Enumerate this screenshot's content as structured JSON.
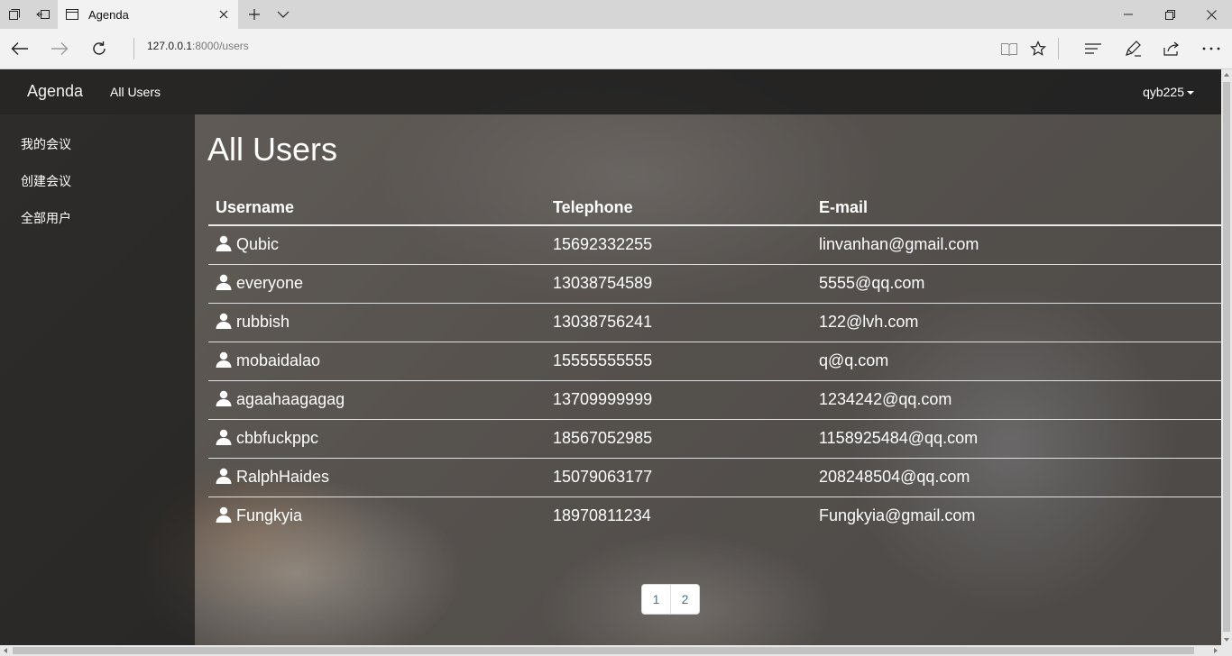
{
  "browser": {
    "tab_title": "Agenda",
    "url_host": "127.0.0.1",
    "url_path": ":8000/users"
  },
  "navbar": {
    "brand": "Agenda",
    "link": "All Users",
    "user": "qyb225"
  },
  "sidebar": {
    "items": [
      {
        "label": "我的会议"
      },
      {
        "label": "创建会议"
      },
      {
        "label": "全部用户"
      }
    ]
  },
  "main": {
    "title": "All Users",
    "columns": [
      "Username",
      "Telephone",
      "E-mail"
    ],
    "rows": [
      {
        "username": "Qubic",
        "telephone": "15692332255",
        "email": "linvanhan@gmail.com"
      },
      {
        "username": "everyone",
        "telephone": "13038754589",
        "email": "5555@qq.com"
      },
      {
        "username": "rubbish",
        "telephone": "13038756241",
        "email": "122@lvh.com"
      },
      {
        "username": "mobaidalao",
        "telephone": "15555555555",
        "email": "q@q.com"
      },
      {
        "username": "agaahaagagag",
        "telephone": "13709999999",
        "email": "1234242@qq.com"
      },
      {
        "username": "cbbfuckppc",
        "telephone": "18567052985",
        "email": "1158925484@qq.com"
      },
      {
        "username": "RalphHaides",
        "telephone": "15079063177",
        "email": "208248504@qq.com"
      },
      {
        "username": "Fungkyia",
        "telephone": "18970811234",
        "email": "Fungkyia@gmail.com"
      }
    ],
    "pages": [
      "1",
      "2"
    ]
  },
  "colors": {
    "link_blue": "#337ab7"
  }
}
